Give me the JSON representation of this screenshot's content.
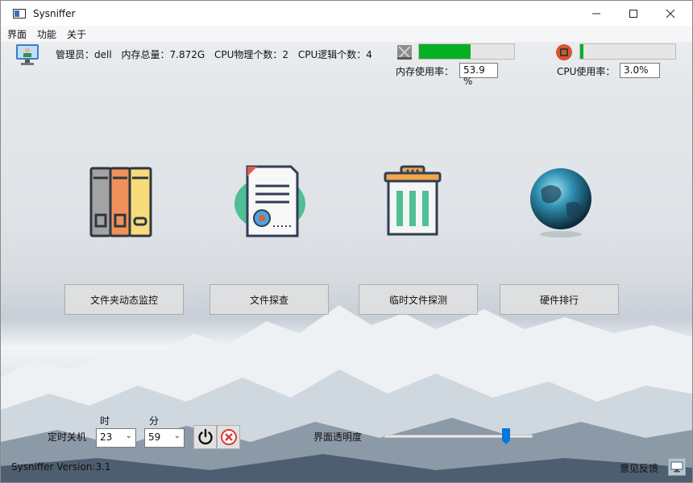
{
  "window": {
    "title": "Sysniffer"
  },
  "menu": [
    "界面",
    "功能",
    "关于"
  ],
  "system_info": {
    "admin": "管理员：dell",
    "mem_total": "内存总量：7.872G",
    "cpu_physical": "CPU物理个数：2",
    "cpu_logical": "CPU逻辑个数：4"
  },
  "memory": {
    "label": "内存使用率：",
    "value": "53.9 %",
    "fraction": 0.539
  },
  "cpu": {
    "label": "CPU使用率：",
    "value": "3.0%",
    "fraction": 0.03
  },
  "features": [
    {
      "label": "文件夹动态监控",
      "icon": "bookshelf-icon"
    },
    {
      "label": "文件探查",
      "icon": "certificate-document-icon"
    },
    {
      "label": "临时文件探测",
      "icon": "trash-bin-icon"
    },
    {
      "label": "硬件排行",
      "icon": "globe-icon"
    }
  ],
  "timer": {
    "label": "定时关机",
    "hour_label": "时",
    "minute_label": "分",
    "hour_value": "23",
    "minute_value": "59",
    "power_icon": "power-icon",
    "cancel_icon": "cancel-icon"
  },
  "opacity": {
    "label": "界面透明度",
    "fraction": 0.82
  },
  "footer": {
    "version": "Sysniffer Version:3.1",
    "feedback": "意见反馈",
    "feedback_icon": "monitor-icon"
  },
  "colors": {
    "progress_fill": "#06b025",
    "slider_thumb": "#0078d7"
  }
}
